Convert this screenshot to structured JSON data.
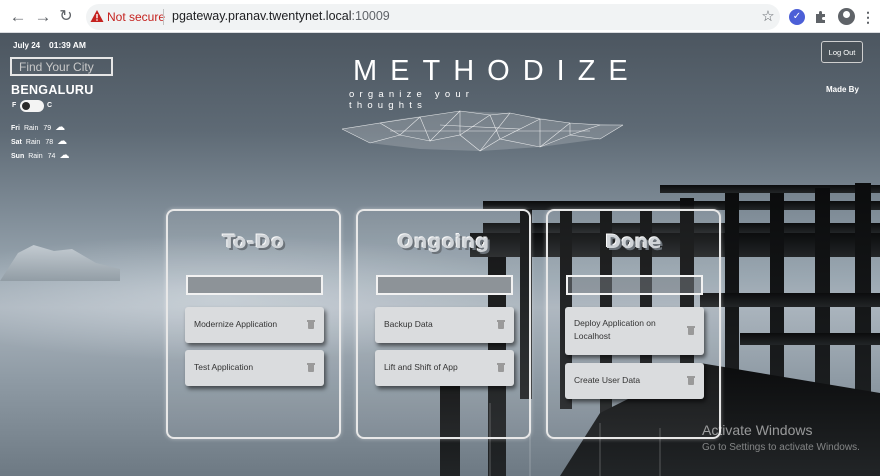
{
  "browser": {
    "not_secure": "Not secure",
    "url_host": "pgateway.pranav.twentynet.local",
    "url_port": ":10009",
    "icons": [
      "back-arrow-icon",
      "forward-arrow-icon",
      "reload-icon",
      "warning-icon",
      "star-icon",
      "extension-icon",
      "puzzle-icon",
      "profile-icon",
      "more-icon"
    ]
  },
  "weather": {
    "date": "July 24",
    "time": "01:39 AM",
    "city_placeholder": "Find Your City",
    "city": "BENGALURU",
    "unit_f": "F",
    "unit_c": "C",
    "forecast": [
      {
        "day": "Fri",
        "condition": "Rain",
        "temp": "79"
      },
      {
        "day": "Sat",
        "condition": "Rain",
        "temp": "78"
      },
      {
        "day": "Sun",
        "condition": "Rain",
        "temp": "74"
      }
    ]
  },
  "header": {
    "brand": "METHODIZE",
    "tagline": "organize your thoughts",
    "logout": "Log Out",
    "made_by": "Made By"
  },
  "board": {
    "columns": [
      {
        "title": "To-Do",
        "cards": [
          "Modernize Application",
          "Test Application"
        ]
      },
      {
        "title": "Ongoing",
        "cards": [
          "Backup Data",
          "Lift and Shift of App"
        ]
      },
      {
        "title": "Done",
        "cards": [
          "Deploy Application on Localhost",
          "Create User Data"
        ]
      }
    ]
  },
  "watermark": {
    "title": "Activate Windows",
    "subtitle": "Go to Settings to activate Windows."
  }
}
